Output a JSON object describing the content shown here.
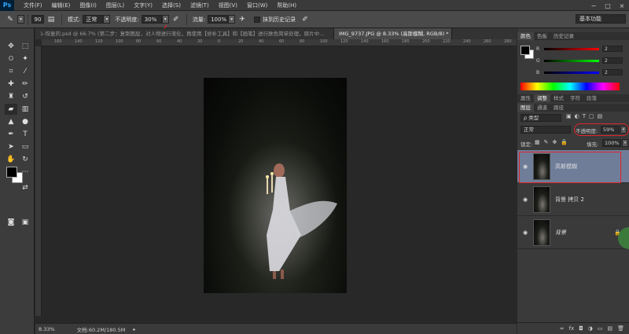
{
  "app": {
    "logo": "Ps"
  },
  "menu": [
    "文件(F)",
    "编辑(E)",
    "图像(I)",
    "图层(L)",
    "文字(Y)",
    "选择(S)",
    "滤镜(T)",
    "视图(V)",
    "窗口(W)",
    "帮助(H)"
  ],
  "window_controls": [
    "−",
    "□",
    "×"
  ],
  "options": {
    "brush_size": "90",
    "mode_label": "模式:",
    "mode_value": "正常",
    "opacity_label": "不透明度:",
    "opacity_value": "30%",
    "flow_label": "流量:",
    "flow_value": "100%",
    "history_label": "抹到历史记录",
    "workspace": "基本功能"
  },
  "tabs": [
    {
      "label": "1-恢复的.psd @ 66.7% (第二步：复制图层，对人物进行液化，再使用【修补工具】和【画笔】进行肤色简单处理，原片中…"
    },
    {
      "label": "IMG_9737.JPG @ 8.33% (高斯模糊, RGB/8) *"
    }
  ],
  "ruler_ticks": [
    "160",
    "140",
    "120",
    "100",
    "80",
    "60",
    "40",
    "20",
    "0",
    "20",
    "40",
    "60",
    "80",
    "100",
    "120",
    "140",
    "160",
    "180",
    "200",
    "220",
    "240",
    "260",
    "280"
  ],
  "status": {
    "zoom": "8.33%",
    "doc": "文档:60.2M/180.5M"
  },
  "color_panel": {
    "tabs": [
      "颜色",
      "色板",
      "历史记录"
    ],
    "r_label": "R",
    "g_label": "G",
    "b_label": "B",
    "r_value": "2",
    "g_value": "2",
    "b_value": "2"
  },
  "adjust_tabs": [
    "属性",
    "调整",
    "样式",
    "字符",
    "段落"
  ],
  "layers_panel": {
    "tabs": [
      "图层",
      "通道",
      "路径"
    ],
    "filter": "ρ 类型",
    "blend_mode": "正常",
    "opacity_label": "不透明度:",
    "opacity_value": "59%",
    "lock_label": "锁定:",
    "fill_label": "填充:",
    "fill_value": "100%",
    "layers": [
      {
        "name": "高斯模糊"
      },
      {
        "name": "背景 拷贝 2"
      },
      {
        "name": "背景"
      }
    ],
    "bottom_icons": [
      "∞",
      "fx",
      "◘",
      "◑",
      "▭",
      "▤",
      "🗑"
    ]
  },
  "colors": {
    "highlight": "#6f7d99",
    "annotation": "#e0242a"
  }
}
